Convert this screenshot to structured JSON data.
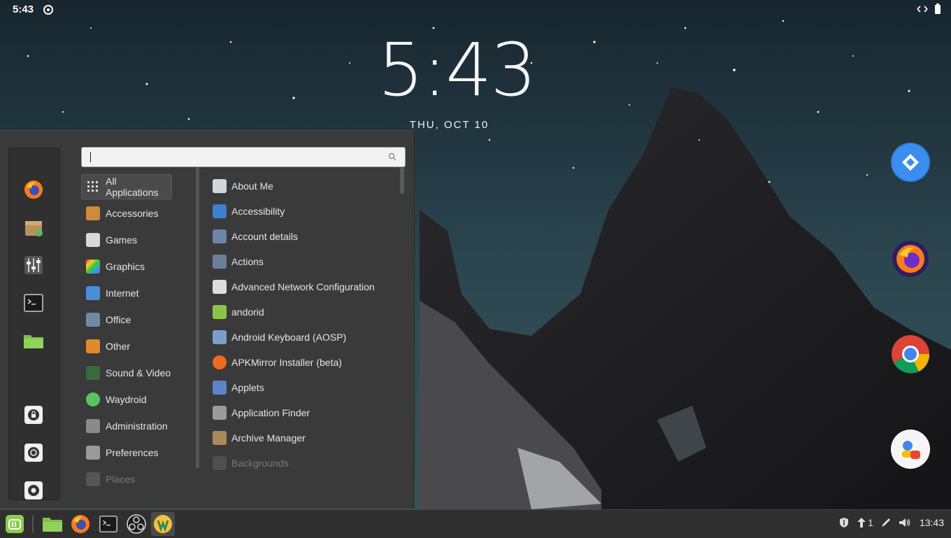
{
  "status_bar": {
    "time": "5:43"
  },
  "clock_widget": {
    "time": "5:43",
    "date": "THU, OCT 10"
  },
  "menu": {
    "search": {
      "value": "",
      "placeholder": ""
    },
    "favorites": [
      "firefox-icon",
      "archive-installer-icon",
      "settings-sliders-icon",
      "terminal-icon",
      "folder-icon"
    ],
    "session_buttons": [
      "lock-screen-icon",
      "logout-icon",
      "shutdown-icon"
    ],
    "categories": [
      {
        "label": "All Applications",
        "icon": "grid-icon",
        "color": "#c9c9c9"
      },
      {
        "label": "Accessories",
        "icon": "calculator-icon",
        "color": "#d08a3b"
      },
      {
        "label": "Games",
        "icon": "games-icon",
        "color": "#d9d9d9"
      },
      {
        "label": "Graphics",
        "icon": "graphics-icon",
        "color": "#b03ab0"
      },
      {
        "label": "Internet",
        "icon": "internet-icon",
        "color": "#4a8ed8"
      },
      {
        "label": "Office",
        "icon": "office-icon",
        "color": "#6f8aa8"
      },
      {
        "label": "Other",
        "icon": "other-icon",
        "color": "#e08a2a"
      },
      {
        "label": "Sound & Video",
        "icon": "sound-video-icon",
        "color": "#3a6a3a"
      },
      {
        "label": "Waydroid",
        "icon": "waydroid-icon",
        "color": "#5cc45c"
      },
      {
        "label": "Administration",
        "icon": "administration-icon",
        "color": "#8a8a8a"
      },
      {
        "label": "Preferences",
        "icon": "preferences-icon",
        "color": "#9a9a9a"
      },
      {
        "label": "Places",
        "icon": "places-icon",
        "color": "#888888"
      }
    ],
    "apps": [
      {
        "label": "About Me",
        "icon": "about-me-icon",
        "color": "#cfd6dc"
      },
      {
        "label": "Accessibility",
        "icon": "accessibility-icon",
        "color": "#3b7fd0"
      },
      {
        "label": "Account details",
        "icon": "account-details-icon",
        "color": "#6a86a8"
      },
      {
        "label": "Actions",
        "icon": "actions-icon",
        "color": "#6c7f99"
      },
      {
        "label": "Advanced Network Configuration",
        "icon": "network-icon",
        "color": "#dddddd"
      },
      {
        "label": "andorid",
        "icon": "android-icon",
        "color": "#8bc34a"
      },
      {
        "label": "Android Keyboard (AOSP)",
        "icon": "keyboard-icon",
        "color": "#7aa0c8"
      },
      {
        "label": "APKMirror Installer (beta)",
        "icon": "apkmirror-icon",
        "color": "#f06a22"
      },
      {
        "label": "Applets",
        "icon": "applets-icon",
        "color": "#5a86c8"
      },
      {
        "label": "Application Finder",
        "icon": "app-finder-icon",
        "color": "#9a9a9a"
      },
      {
        "label": "Archive Manager",
        "icon": "archive-manager-icon",
        "color": "#a88a5a"
      },
      {
        "label": "Backgrounds",
        "icon": "backgrounds-icon",
        "color": "#777777"
      }
    ]
  },
  "taskbar": {
    "items": [
      "mint-menu-icon",
      "files-icon",
      "firefox-icon",
      "terminal-icon",
      "obs-icon",
      "waydroid-icon"
    ],
    "tray": {
      "badge_count": "1",
      "time": "13:43"
    }
  }
}
